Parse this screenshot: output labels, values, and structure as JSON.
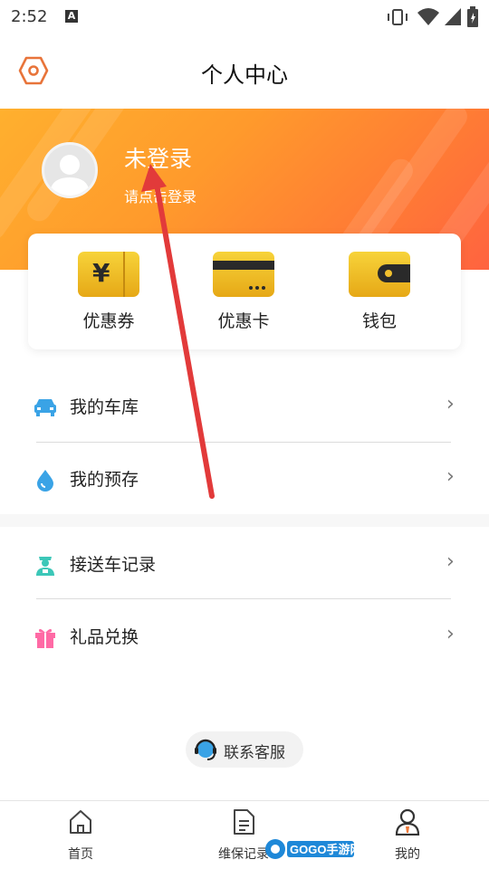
{
  "status_bar": {
    "time": "2:52",
    "notification_icon_letter": "A",
    "icons": [
      "vibrate-icon",
      "wifi-icon",
      "signal-icon",
      "battery-icon"
    ]
  },
  "header": {
    "title": "个人中心",
    "settings_icon": "settings-hexagon-icon"
  },
  "profile": {
    "status": "未登录",
    "hint": "请点击登录",
    "avatar_icon": "default-avatar-icon"
  },
  "quick_actions": [
    {
      "label": "优惠券",
      "icon": "coupon-icon",
      "glyph": "¥"
    },
    {
      "label": "优惠卡",
      "icon": "discount-card-icon"
    },
    {
      "label": "钱包",
      "icon": "wallet-icon"
    }
  ],
  "menu_group_1": [
    {
      "label": "我的车库",
      "icon": "car-icon"
    },
    {
      "label": "我的预存",
      "icon": "water-drop-icon"
    }
  ],
  "menu_group_2": [
    {
      "label": "接送车记录",
      "icon": "driver-icon"
    },
    {
      "label": "礼品兑换",
      "icon": "gift-icon"
    }
  ],
  "chevron": "›",
  "contact": {
    "label": "联系客服",
    "icon": "headset-icon"
  },
  "bottom_nav": [
    {
      "label": "首页",
      "icon": "home-icon"
    },
    {
      "label": "维保记录",
      "icon": "document-icon"
    },
    {
      "label": "我的",
      "icon": "user-icon"
    }
  ],
  "watermark": "GOGO手游网",
  "colors": {
    "banner_start": "#ffb02e",
    "banner_end": "#ff6340",
    "accent_orange": "#f07a3a",
    "icon_blue": "#3aa3e6",
    "icon_teal": "#3cc7b8",
    "icon_pink": "#ff6aa5",
    "card_gold": "#f2c02e",
    "annotation_red": "#e23a3a"
  }
}
